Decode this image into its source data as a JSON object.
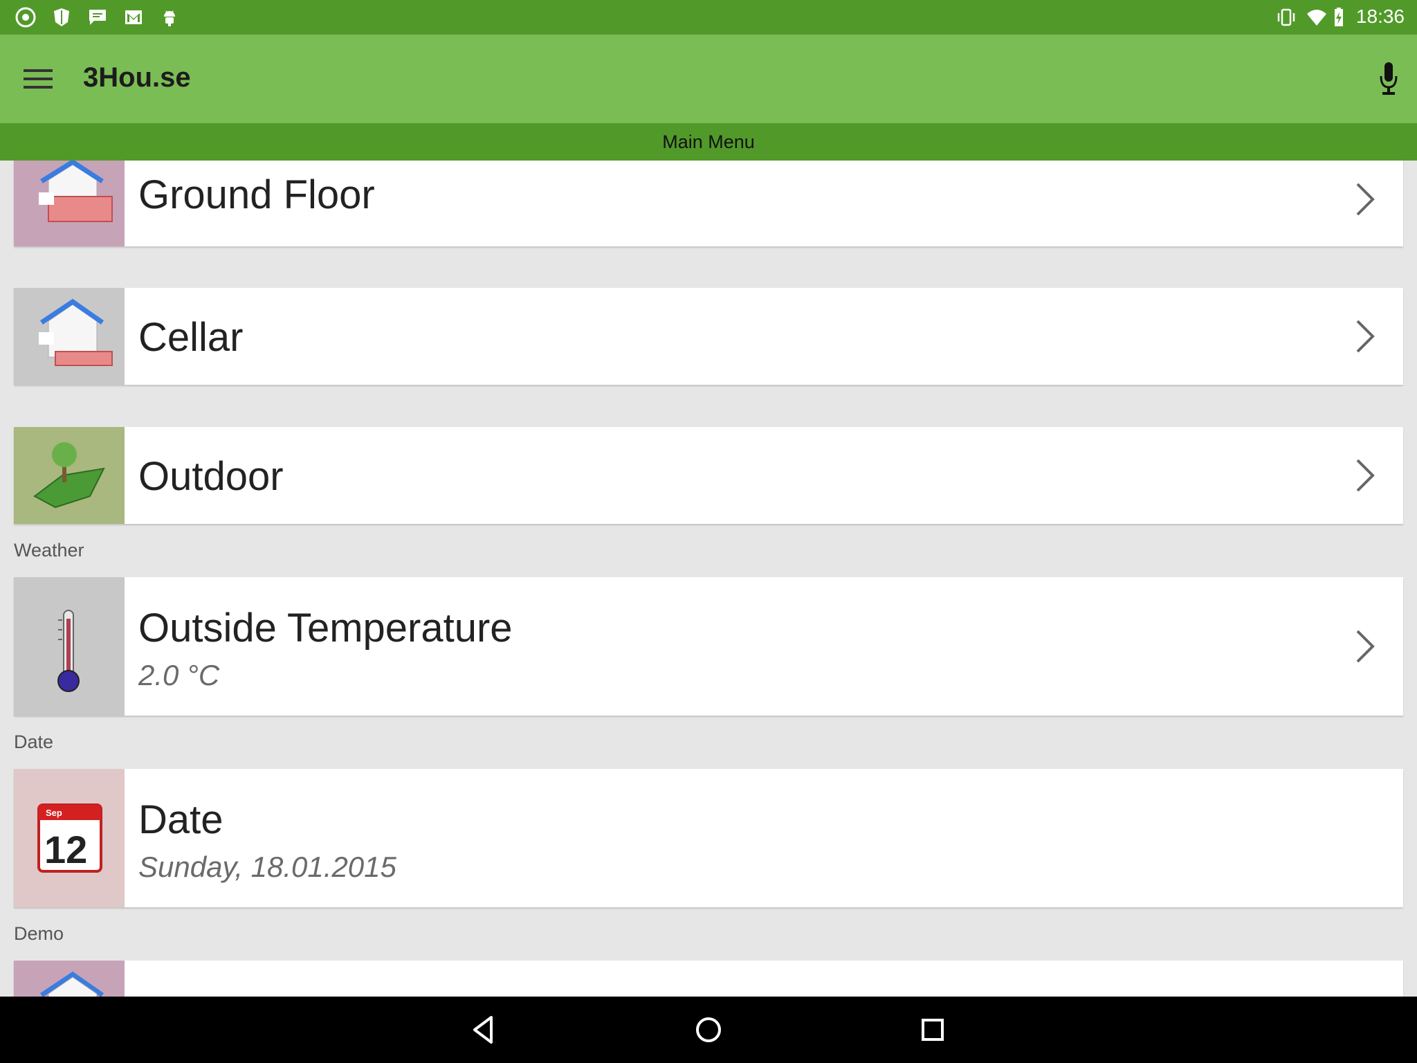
{
  "status_bar": {
    "time": "18:36",
    "left_icons": [
      "chrome-icon",
      "shield-icon",
      "chat-icon",
      "gmail-icon",
      "android-icon"
    ],
    "right_icons": [
      "vibrate-icon",
      "wifi-icon",
      "battery-charging-icon"
    ]
  },
  "app_bar": {
    "title": "3Hou.se",
    "menu_icon": "hamburger-icon",
    "voice_icon": "microphone-icon"
  },
  "sub_header": {
    "title": "Main Menu"
  },
  "items": [
    {
      "title": "Ground Floor",
      "icon": "house-ground-floor-icon",
      "thumb_color": "#c7a3b8"
    },
    {
      "title": "Cellar",
      "icon": "house-cellar-icon",
      "thumb_color": "#c8c8c8"
    },
    {
      "title": "Outdoor",
      "icon": "outdoor-tree-icon",
      "thumb_color": "#a8b87e"
    },
    {
      "title": "Outside Temperature",
      "subtitle": "2.0 °C",
      "icon": "thermometer-icon",
      "thumb_color": "#c8c8c8"
    },
    {
      "title": "Date",
      "subtitle": "Sunday, 18.01.2015",
      "icon": "calendar-icon",
      "thumb_color": "#e0c8c8"
    }
  ],
  "calendar_icon": {
    "month": "Sep",
    "day": "12"
  },
  "sections": {
    "weather": "Weather",
    "date": "Date",
    "demo": "Demo"
  },
  "colors": {
    "status_bar": "#519a29",
    "app_bar": "#7bbd55",
    "sub_bar": "#519a29",
    "background": "#e6e6e6"
  }
}
